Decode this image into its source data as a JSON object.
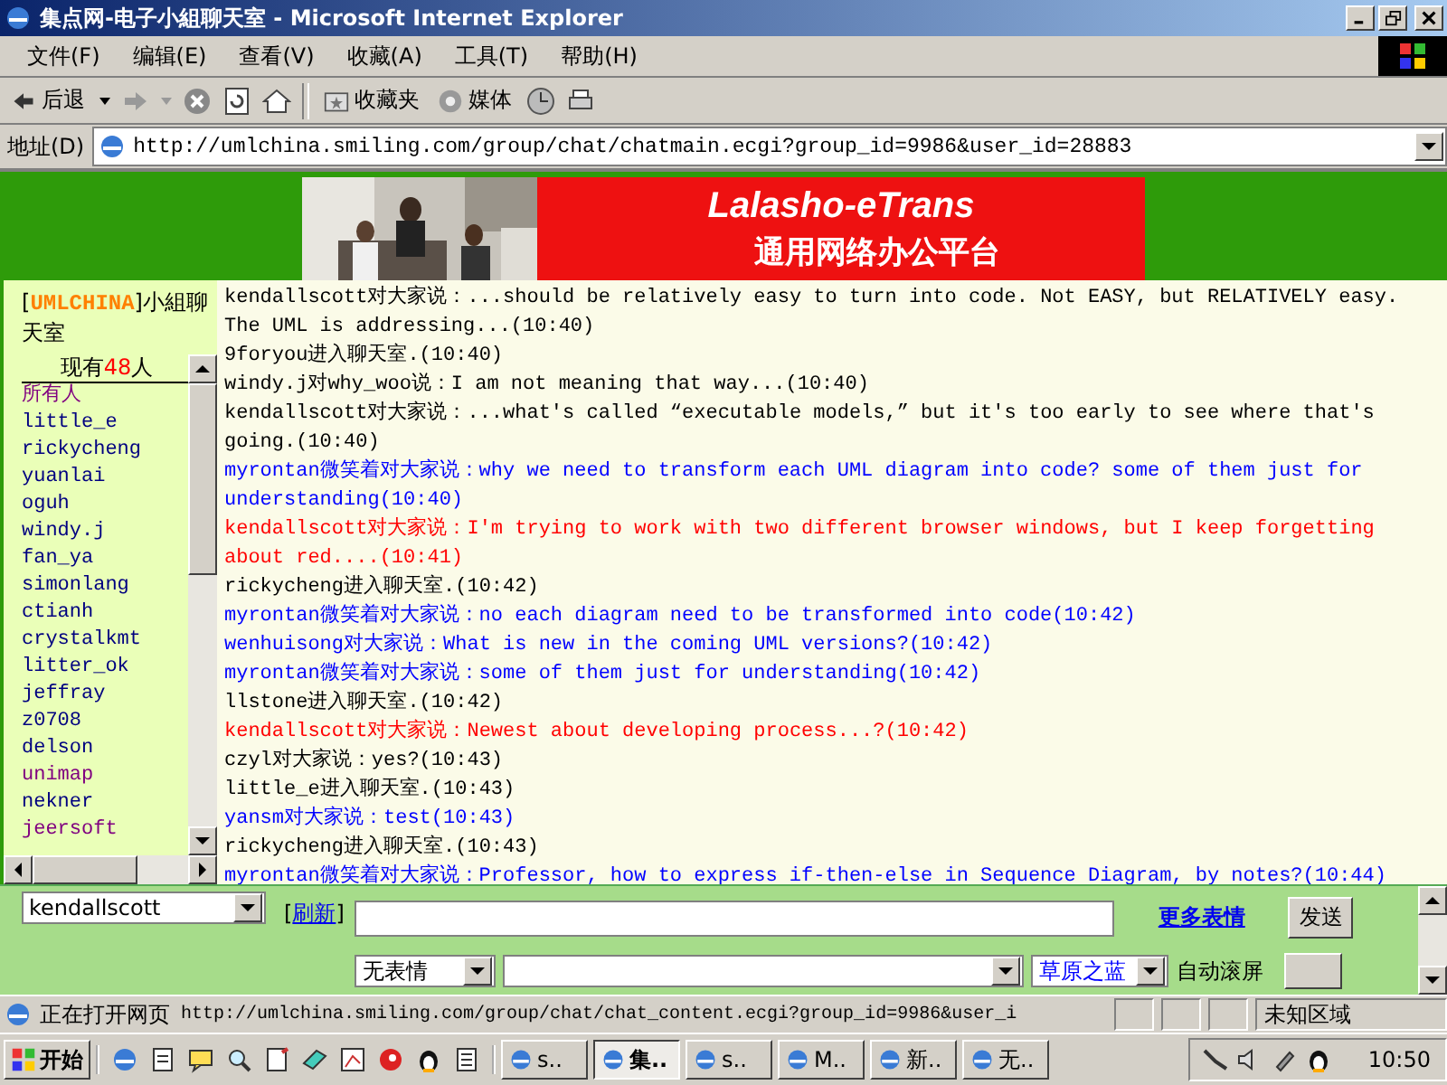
{
  "window": {
    "title": "集点网-电子小組聊天室 - Microsoft Internet Explorer"
  },
  "menu": [
    "文件(F)",
    "编辑(E)",
    "查看(V)",
    "收藏(A)",
    "工具(T)",
    "帮助(H)"
  ],
  "toolbar": {
    "back": "后退",
    "favorites": "收藏夹",
    "media": "媒体"
  },
  "address": {
    "label": "地址(D)",
    "url": "http://umlchina.smiling.com/group/chat/chatmain.ecgi?group_id=9986&user_id=28883"
  },
  "banner": {
    "brand": "Lalasho-eTrans",
    "subtitle": "通用网络办公平台"
  },
  "room": {
    "before": "[",
    "brand": "UMLCHINA",
    "after": "]小組聊天室",
    "count_before": "现有",
    "count": "48",
    "count_after": "人"
  },
  "users": [
    {
      "name": "所有人",
      "color": "#800080"
    },
    {
      "name": "little_e",
      "color": "#000080"
    },
    {
      "name": "rickycheng",
      "color": "#000080"
    },
    {
      "name": "yuanlai",
      "color": "#000080"
    },
    {
      "name": "oguh",
      "color": "#000080"
    },
    {
      "name": "windy.j",
      "color": "#000080"
    },
    {
      "name": "fan_ya",
      "color": "#000080"
    },
    {
      "name": "simonlang",
      "color": "#000080"
    },
    {
      "name": "ctianh",
      "color": "#000080"
    },
    {
      "name": "crystalkmt",
      "color": "#000080"
    },
    {
      "name": "litter_ok",
      "color": "#000080"
    },
    {
      "name": "jeffray",
      "color": "#000080"
    },
    {
      "name": "z0708",
      "color": "#000080"
    },
    {
      "name": "delson",
      "color": "#000080"
    },
    {
      "name": "unimap",
      "color": "#800080"
    },
    {
      "name": "nekner",
      "color": "#000080"
    },
    {
      "name": "jeersoft",
      "color": "#800080"
    }
  ],
  "messages": [
    {
      "text": "kendallscott对大家说：...should be relatively easy to turn into code. Not EASY, but RELATIVELY easy. The UML is addressing...(10:40)",
      "color": "#000000"
    },
    {
      "text": "9foryou进入聊天室.(10:40)",
      "color": "#000000"
    },
    {
      "text": "windy.j对why_woo说：I am not meaning that way...(10:40)",
      "color": "#000000"
    },
    {
      "text": "kendallscott对大家说：...what's called “executable models,” but it's too early to see where that's going.(10:40)",
      "color": "#000000"
    },
    {
      "text": "myrontan微笑着对大家说：why we need to transform each UML diagram into code? some of them just for understanding(10:40)",
      "color": "#0000ff"
    },
    {
      "text": "kendallscott对大家说：I'm trying to work with two different browser windows, but I keep forgetting about red....(10:41)",
      "color": "#ff0000"
    },
    {
      "text": "rickycheng进入聊天室.(10:42)",
      "color": "#000000"
    },
    {
      "text": "myrontan微笑着对大家说：no each diagram need to be transformed into code(10:42)",
      "color": "#0000ff"
    },
    {
      "text": "wenhuisong对大家说：What is new in the coming UML versions?(10:42)",
      "color": "#0000ff"
    },
    {
      "text": "myrontan微笑着对大家说：some of them just for understanding(10:42)",
      "color": "#0000ff"
    },
    {
      "text": "llstone进入聊天室.(10:42)",
      "color": "#000000"
    },
    {
      "text": "kendallscott对大家说：Newest about developing process...?(10:42)",
      "color": "#ff0000"
    },
    {
      "text": "czyl对大家说：yes?(10:43)",
      "color": "#000000"
    },
    {
      "text": "little_e进入聊天室.(10:43)",
      "color": "#000000"
    },
    {
      "text": "yansm对大家说：test(10:43)",
      "color": "#0000ff"
    },
    {
      "text": "rickycheng进入聊天室.(10:43)",
      "color": "#000000"
    },
    {
      "text": "myrontan微笑着对大家说：Professor, how to express if-then-else in Sequence Diagram, by notes?(10:44)",
      "color": "#0000ff"
    }
  ],
  "form": {
    "speaker": "kendallscott",
    "refresh_before": "[",
    "refresh": "刷新",
    "refresh_after": "]",
    "more_emotes": "更多表情",
    "send": "发送",
    "emote": "无表情",
    "theme": "草原之蓝",
    "autoscroll": "自动滚屏"
  },
  "status_bar": {
    "message": "正在打开网页",
    "url": "http://umlchina.smiling.com/group/chat/chat_content.ecgi?group_id=9986&user_i",
    "zone": "未知区域"
  },
  "taskbar": {
    "start": "开始",
    "tasks": [
      {
        "label": "s..",
        "selected": false
      },
      {
        "label": "集..",
        "selected": true
      },
      {
        "label": "s..",
        "selected": false
      },
      {
        "label": "M..",
        "selected": false
      },
      {
        "label": "新..",
        "selected": false
      },
      {
        "label": "无..",
        "selected": false
      }
    ],
    "clock": "10:50"
  }
}
